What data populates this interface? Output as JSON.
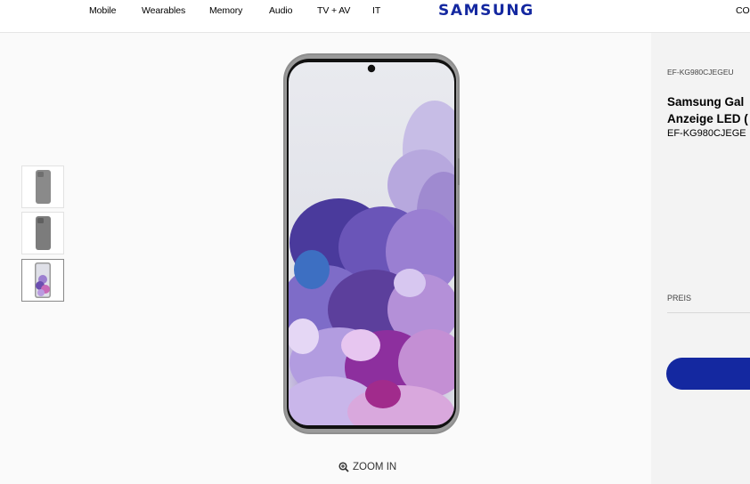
{
  "header": {
    "nav": [
      "Mobile",
      "Wearables",
      "Memory",
      "Audio",
      "TV + AV",
      "IT"
    ],
    "logo": "SAMSUNG",
    "right_link": "CO"
  },
  "gallery": {
    "thumbnails": [
      {
        "name": "gray-case-back",
        "active": false
      },
      {
        "name": "gray-case-back-alt",
        "active": false
      },
      {
        "name": "case-with-phone-front",
        "active": true
      }
    ],
    "zoom_label": "ZOOM IN"
  },
  "product": {
    "sku_small": "EF-KG980CJEGEU",
    "title_line1": "Samsung Gal",
    "title_line2": "Anzeige LED (",
    "sku": "EF-KG980CJEGE",
    "price_label": "PREIS"
  },
  "colors": {
    "brand": "#1428a0",
    "case": "#8e8e8e"
  }
}
